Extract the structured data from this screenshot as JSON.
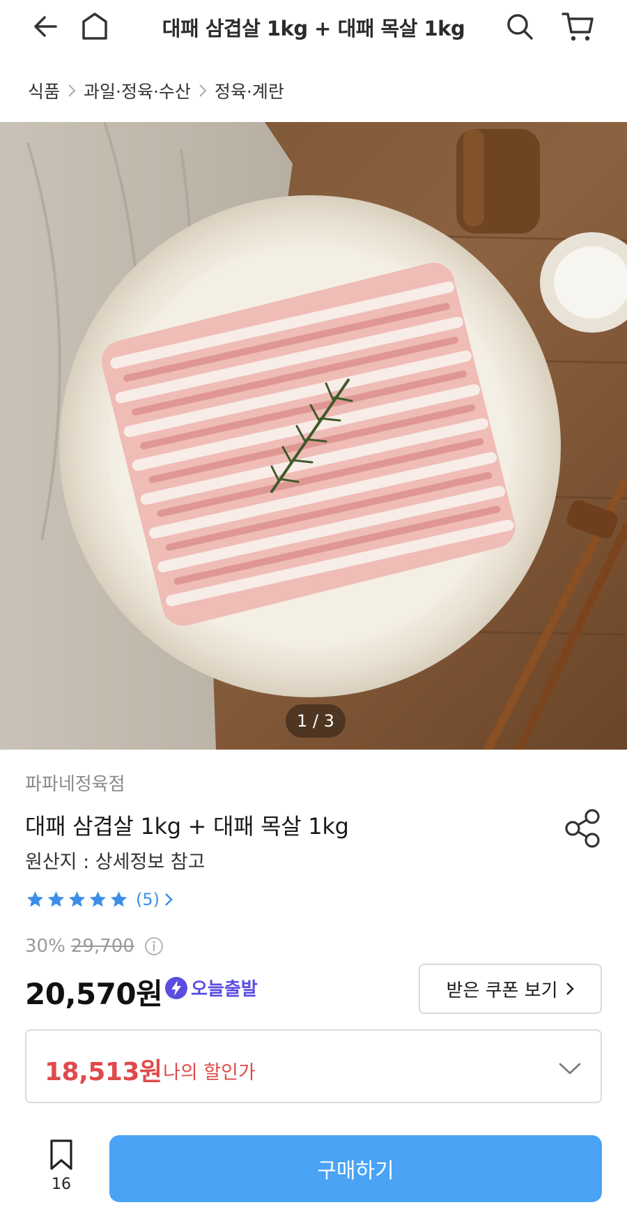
{
  "header": {
    "title": "대패 삼겹살 1kg + 대패 목살 1kg"
  },
  "breadcrumb": {
    "items": [
      "식품",
      "과일·정육·수산",
      "정육·계란"
    ]
  },
  "gallery": {
    "pager": "1 / 3"
  },
  "product": {
    "seller": "파파네정육점",
    "name": "대패 삼겹살 1kg + 대패 목살 1kg",
    "origin": "원산지 : 상세정보 참고",
    "rating_stars": 5,
    "review_count": "(5)",
    "discount_rate": "30%",
    "original_price": "29,700",
    "price": "20,570원",
    "badge": "오늘출발",
    "coupon_button": "받은 쿠폰 보기",
    "my_price": "18,513원",
    "my_price_label": "나의 할인가"
  },
  "bottom_bar": {
    "bookmark_count": "16",
    "buy_label": "구매하기"
  },
  "colors": {
    "accent": "#4aa3f5",
    "star": "#3d8ee6",
    "discount_red": "#e04a4a",
    "badge_purple": "#5b4de0"
  }
}
